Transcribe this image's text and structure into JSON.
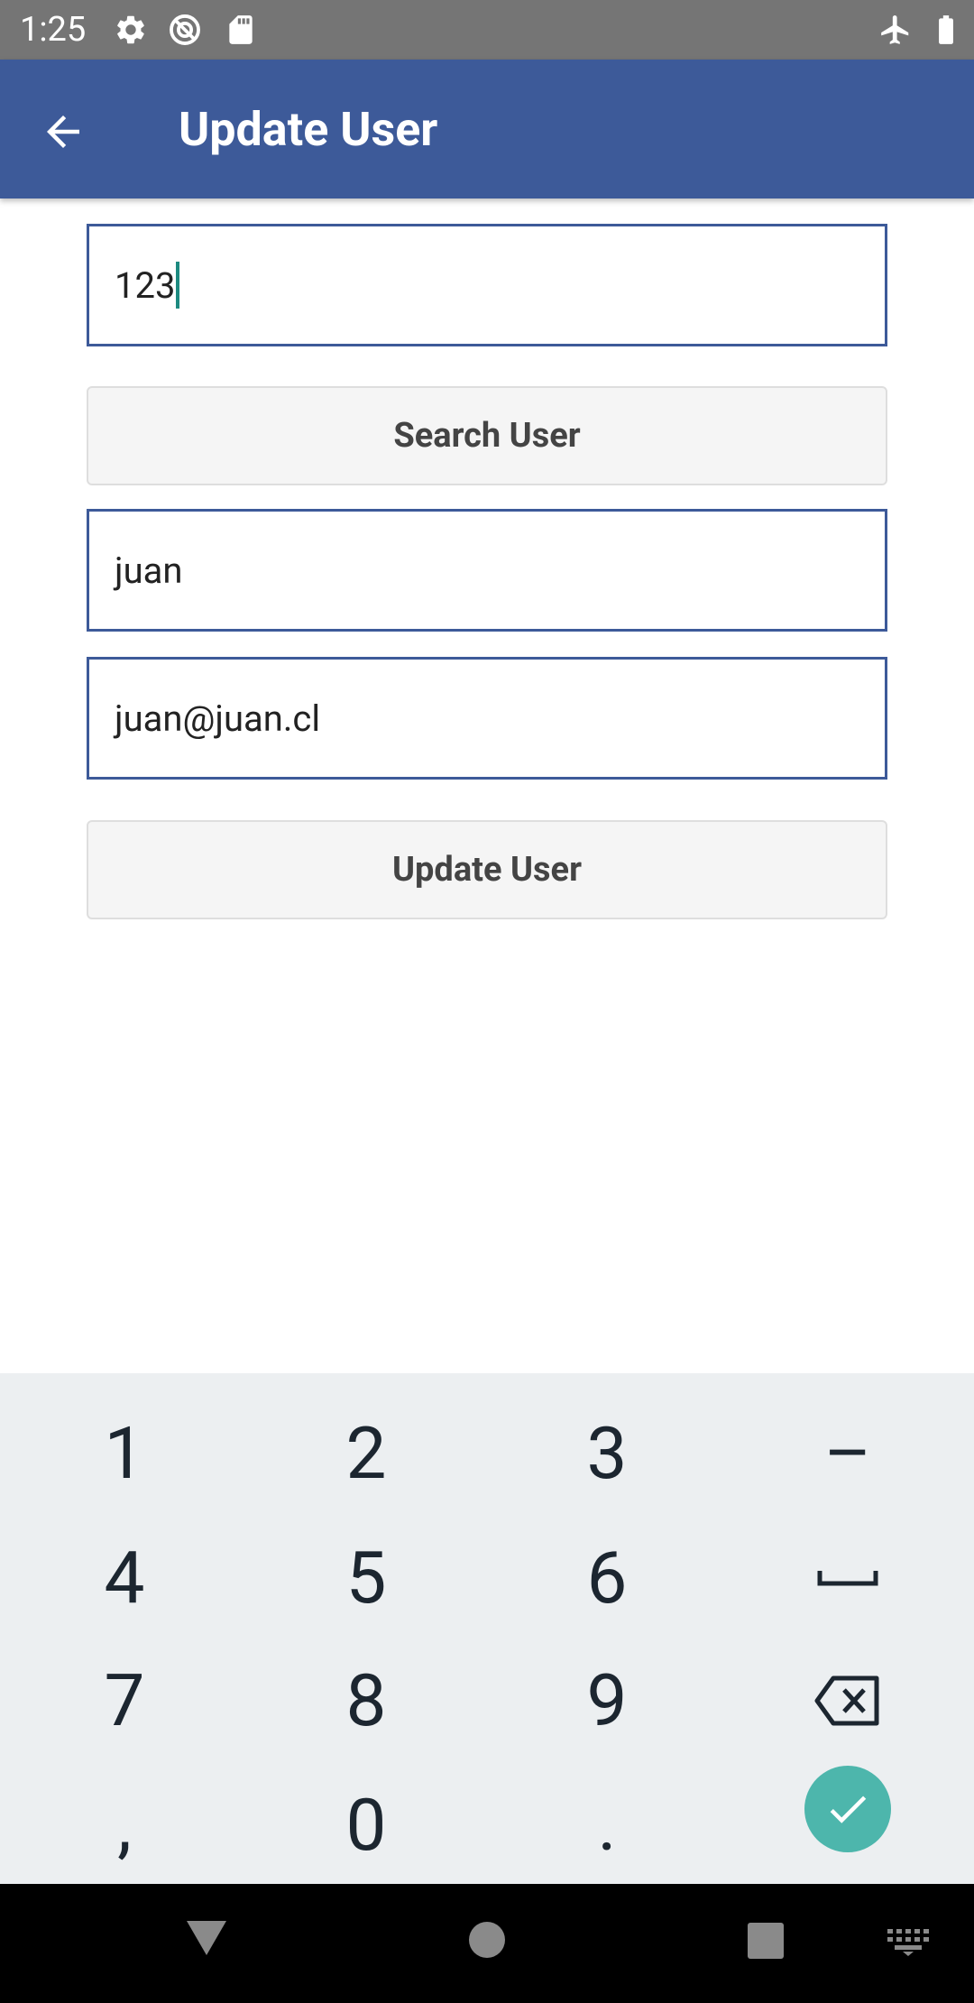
{
  "status_bar": {
    "time": "1:25",
    "icons": [
      "settings-icon",
      "no-sync-icon",
      "sd-card-icon",
      "airplane-icon",
      "battery-icon"
    ],
    "background": "#757575"
  },
  "app_bar": {
    "title": "Update User",
    "back_icon": "arrow-left-icon",
    "background": "#3d5a99"
  },
  "form": {
    "id_field_value": "123",
    "search_button_label": "Search User",
    "name_field_value": "juan",
    "email_field_value": "juan@juan.cl",
    "update_button_label": "Update User"
  },
  "keyboard": {
    "rows": [
      [
        "1",
        "2",
        "3",
        "–"
      ],
      [
        "4",
        "5",
        "6",
        "space"
      ],
      [
        "7",
        "8",
        "9",
        "backspace"
      ],
      [
        ",",
        "0",
        ".",
        "done"
      ]
    ],
    "done_color": "#4db6ac"
  },
  "nav_bar": {
    "icons": [
      "back-triangle-icon",
      "home-circle-icon",
      "recents-square-icon",
      "keyboard-switch-icon"
    ]
  }
}
